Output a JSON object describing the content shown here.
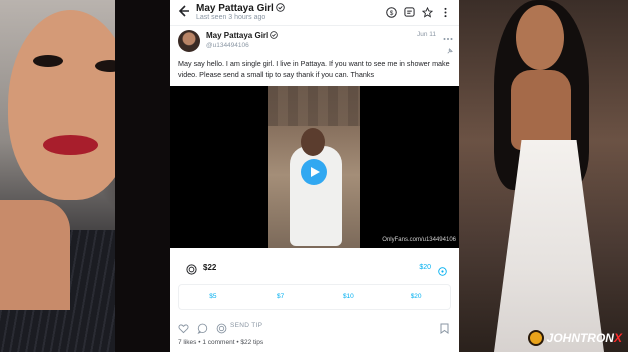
{
  "topbar": {
    "title": "May Pattaya Girl",
    "subtitle": "Last seen 3 hours ago"
  },
  "author": {
    "name": "May Pattaya Girl",
    "handle": "@u134494106",
    "date": "Jun 11"
  },
  "post": {
    "text": "May say hello. I am single girl. I live in Pattaya. If you want to see me in shower make video. Please send a small tip to say thank if you can. Thanks"
  },
  "media": {
    "watermark": "OnlyFans.com/u134494106"
  },
  "tip": {
    "amount": "$22",
    "alt_amount": "$20",
    "options": [
      "$5",
      "$7",
      "$10",
      "$20"
    ]
  },
  "actions": {
    "send_tip_label": "SEND TIP"
  },
  "stats": {
    "likes": "7 likes",
    "comments": "1 comment",
    "tips": "$22 tips"
  },
  "brand": {
    "name_main": "JOHNTRON",
    "name_x": "X"
  },
  "colors": {
    "accent": "#00aff0",
    "play_button": "#1da1f2",
    "text_primary": "#1a1a1a",
    "text_muted": "#8a96a3"
  }
}
